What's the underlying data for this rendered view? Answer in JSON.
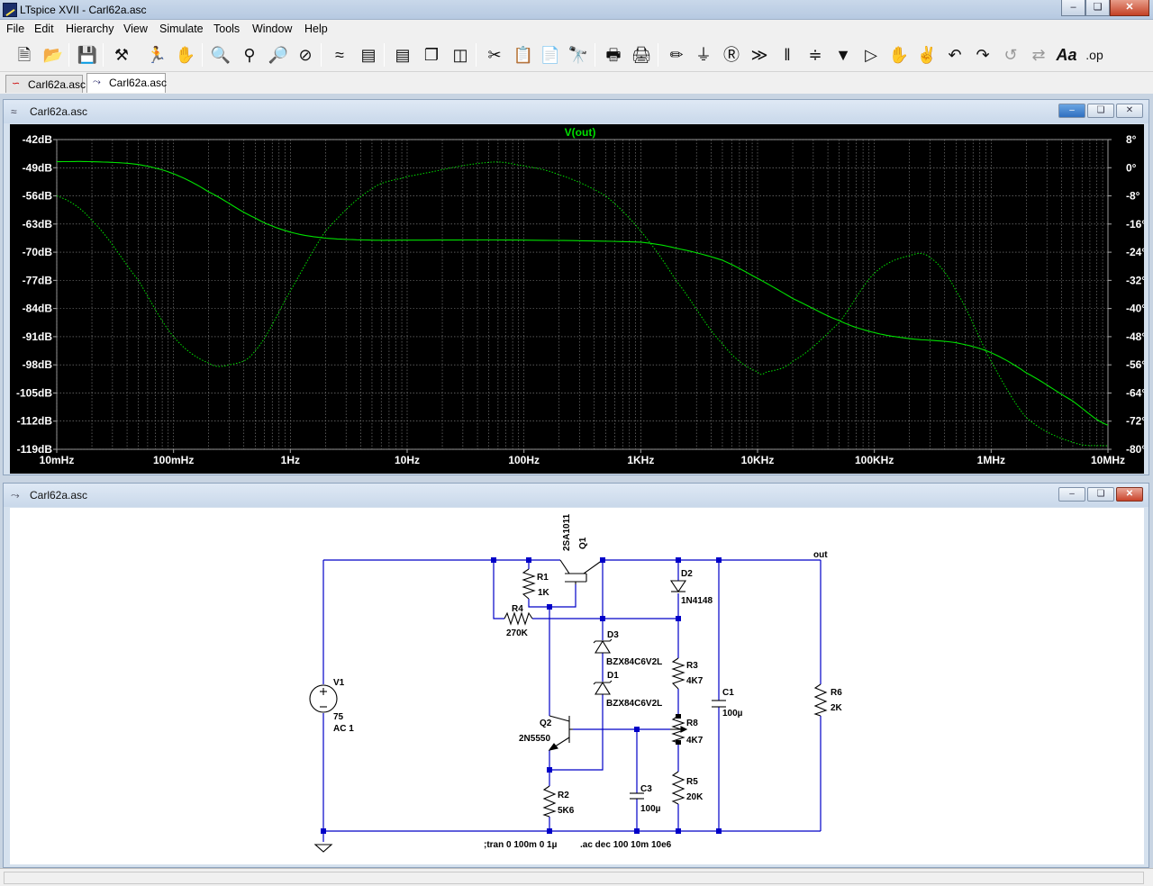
{
  "window": {
    "title": "LTspice XVII - Carl62a.asc"
  },
  "menu": [
    "File",
    "Edit",
    "Hierarchy",
    "View",
    "Simulate",
    "Tools",
    "Window",
    "Help"
  ],
  "toolbar": [
    "new-schematic-icon",
    "open-icon",
    "save-icon",
    "control-panel-icon",
    "run-icon",
    "halt-icon",
    "zoom-in-icon",
    "zoom-pan-icon",
    "zoom-out-icon",
    "zoom-cancel-icon",
    "autorange-icon",
    "manual-limits-icon",
    "tile-horizontal-icon",
    "cascade-icon",
    "tile-vertical-icon",
    "cut-icon",
    "copy-icon",
    "paste-icon",
    "find-icon",
    "print-preview-icon",
    "print-icon",
    "draw-wire-icon",
    "ground-icon",
    "label-net-icon",
    "resistor-icon",
    "capacitor-icon",
    "inductor-icon",
    "diode-icon",
    "component-icon",
    "move-icon",
    "drag-icon",
    "undo-icon",
    "redo-icon",
    "rotate-icon",
    "mirror-icon",
    "text-icon",
    "spice-directive-icon"
  ],
  "tabs": [
    {
      "label": "Carl62a.asc",
      "kind": "waveform",
      "active": false
    },
    {
      "label": "Carl62a.asc",
      "kind": "schematic",
      "active": true
    }
  ],
  "plot_window": {
    "title": "Carl62a.asc"
  },
  "schematic_window": {
    "title": "Carl62a.asc"
  },
  "chart_data": {
    "type": "line",
    "title": "V(out)",
    "x_scale": "log",
    "xlim": [
      0.01,
      10000000
    ],
    "x_ticks": [
      0.01,
      0.1,
      1,
      10,
      100,
      1000,
      10000,
      100000,
      1000000,
      10000000
    ],
    "x_tick_labels": [
      "10mHz",
      "100mHz",
      "1Hz",
      "10Hz",
      "100Hz",
      "1KHz",
      "10KHz",
      "100KHz",
      "1MHz",
      "10MHz"
    ],
    "ylim": [
      -119,
      -42
    ],
    "y_ticks": [
      -42,
      -49,
      -56,
      -63,
      -70,
      -77,
      -84,
      -91,
      -98,
      -105,
      -112,
      -119
    ],
    "y_tick_labels": [
      "-42dB",
      "-49dB",
      "-56dB",
      "-63dB",
      "-70dB",
      "-77dB",
      "-84dB",
      "-91dB",
      "-98dB",
      "-105dB",
      "-112dB",
      "-119dB"
    ],
    "y2lim": [
      -80,
      8
    ],
    "y2_ticks": [
      8,
      0,
      -8,
      -16,
      -24,
      -32,
      -40,
      -48,
      -56,
      -64,
      -72,
      -80
    ],
    "y2_tick_labels": [
      "8°",
      "0°",
      "-8°",
      "-16°",
      "-24°",
      "-32°",
      "-40°",
      "-48°",
      "-56°",
      "-64°",
      "-72°",
      "-80°"
    ],
    "grid": true,
    "color": "#00e000",
    "background": "#000000",
    "series": [
      {
        "name": "V(out)",
        "axis": "left",
        "style": "solid",
        "x": [
          0.01,
          0.02,
          0.05,
          0.1,
          0.2,
          0.5,
          1,
          2,
          5,
          10,
          100,
          1000,
          2000,
          5000,
          10000,
          20000,
          50000,
          100000,
          200000,
          500000,
          1000000,
          2000000,
          5000000,
          10000000
        ],
        "y": [
          -47.5,
          -47.5,
          -48.2,
          -50.5,
          -55,
          -61.5,
          -65,
          -66.5,
          -67,
          -67,
          -67,
          -67.5,
          -69,
          -72,
          -76.5,
          -81.5,
          -87,
          -90,
          -91.5,
          -92.5,
          -95,
          -100,
          -107,
          -113
        ]
      },
      {
        "name": "phase",
        "axis": "right",
        "style": "dotted",
        "x": [
          0.01,
          0.02,
          0.05,
          0.1,
          0.2,
          0.3,
          0.5,
          1,
          2,
          5,
          10,
          50,
          100,
          200,
          500,
          1000,
          2000,
          5000,
          10000,
          12000,
          20000,
          50000,
          100000,
          200000,
          300000,
          500000,
          1000000,
          2000000,
          5000000,
          10000000
        ],
        "y": [
          -8,
          -15,
          -32,
          -48,
          -55.5,
          -56,
          -52,
          -35,
          -18,
          -6,
          -2.5,
          1.5,
          0.5,
          -2,
          -8,
          -18,
          -32,
          -50,
          -58,
          -58,
          -55,
          -44,
          -30,
          -25,
          -25.5,
          -35,
          -55,
          -71,
          -78,
          -79
        ]
      }
    ]
  },
  "schematic": {
    "labels": {
      "q1_model": "2SA1011",
      "q1_name": "Q1",
      "r1_name": "R1",
      "r1_value": "1K",
      "r4_name": "R4",
      "r4_value": "270K",
      "d2_name": "D2",
      "d2_value": "1N4148",
      "d3_name": "D3",
      "d3_value": "BZX84C6V2L",
      "d1_name": "D1",
      "d1_value": "BZX84C6V2L",
      "r3_name": "R3",
      "r3_value": "4K7",
      "c1_name": "C1",
      "c1_value": "100µ",
      "r6_name": "R6",
      "r6_value": "2K",
      "r8_name": "R8",
      "r8_value": "4K7",
      "q2_name": "Q2",
      "q2_model": "2N5550",
      "r2_name": "R2",
      "r2_value": "5K6",
      "c3_name": "C3",
      "c3_value": "100µ",
      "r5_name": "R5",
      "r5_value": "20K",
      "v1_name": "V1",
      "v1_value": "75",
      "v1_ac": "AC 1",
      "net_out": "out",
      "directive_tran": ";tran 0 100m 0 1µ",
      "directive_ac": ".ac dec 100 10m 10e6"
    }
  }
}
